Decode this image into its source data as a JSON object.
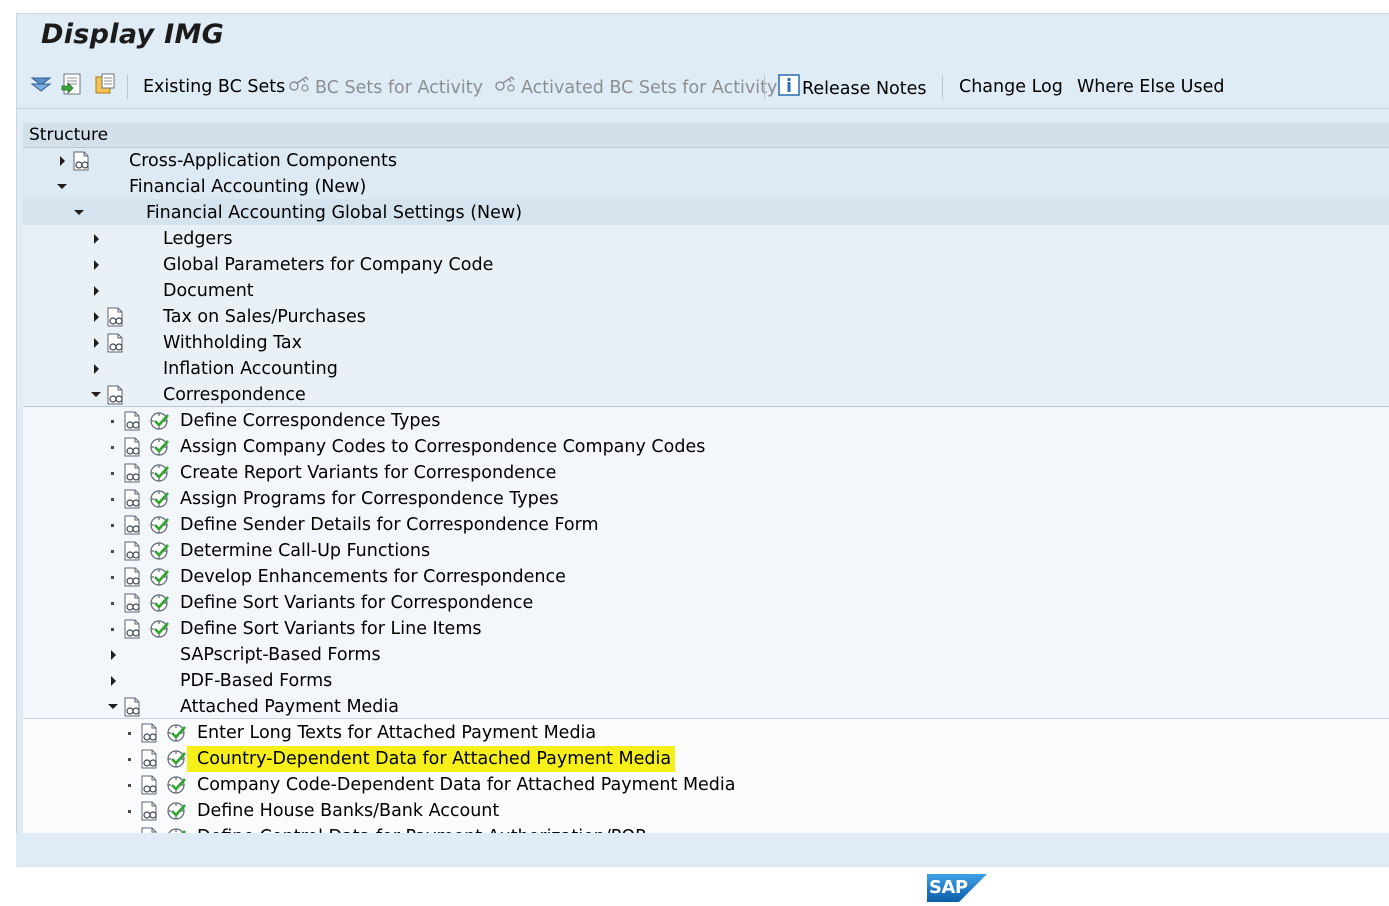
{
  "window": {
    "title": "Display IMG"
  },
  "toolbar": {
    "existing_bc_sets": "Existing BC Sets",
    "bc_sets_for_activity": "BC Sets for Activity",
    "activated_bc_sets_for_activity": "Activated BC Sets for Activity",
    "release_notes": "Release Notes",
    "change_log": "Change Log",
    "where_else_used": "Where Else Used"
  },
  "structure": {
    "header": "Structure",
    "rows": [
      {
        "text": "Cross-Application Components",
        "level": 0,
        "expander": "collapsed",
        "doc_icon": true,
        "exec_icon": false
      },
      {
        "text": "Financial Accounting (New)",
        "level": 0,
        "expander": "expanded",
        "doc_icon": false,
        "exec_icon": false
      },
      {
        "text": "Financial Accounting Global Settings (New)",
        "level": 1,
        "expander": "expanded",
        "doc_icon": false,
        "exec_icon": false
      },
      {
        "text": "Ledgers",
        "level": 2,
        "expander": "collapsed",
        "doc_icon": false,
        "exec_icon": false
      },
      {
        "text": "Global Parameters for Company Code",
        "level": 2,
        "expander": "collapsed",
        "doc_icon": false,
        "exec_icon": false
      },
      {
        "text": "Document",
        "level": 2,
        "expander": "collapsed",
        "doc_icon": false,
        "exec_icon": false
      },
      {
        "text": "Tax on Sales/Purchases",
        "level": 2,
        "expander": "collapsed",
        "doc_icon": true,
        "exec_icon": false
      },
      {
        "text": "Withholding Tax",
        "level": 2,
        "expander": "collapsed",
        "doc_icon": true,
        "exec_icon": false
      },
      {
        "text": "Inflation Accounting",
        "level": 2,
        "expander": "collapsed",
        "doc_icon": false,
        "exec_icon": false
      },
      {
        "text": "Correspondence",
        "level": 2,
        "expander": "expanded",
        "doc_icon": true,
        "exec_icon": false
      },
      {
        "text": "Define Correspondence Types",
        "level": 3,
        "expander": "leaf",
        "doc_icon": true,
        "exec_icon": true
      },
      {
        "text": "Assign Company Codes to Correspondence Company Codes",
        "level": 3,
        "expander": "leaf",
        "doc_icon": true,
        "exec_icon": true
      },
      {
        "text": "Create Report Variants for Correspondence",
        "level": 3,
        "expander": "leaf",
        "doc_icon": true,
        "exec_icon": true
      },
      {
        "text": "Assign Programs for Correspondence Types",
        "level": 3,
        "expander": "leaf",
        "doc_icon": true,
        "exec_icon": true
      },
      {
        "text": "Define Sender Details for Correspondence Form",
        "level": 3,
        "expander": "leaf",
        "doc_icon": true,
        "exec_icon": true
      },
      {
        "text": "Determine Call-Up Functions",
        "level": 3,
        "expander": "leaf",
        "doc_icon": true,
        "exec_icon": true
      },
      {
        "text": "Develop Enhancements for Correspondence",
        "level": 3,
        "expander": "leaf",
        "doc_icon": true,
        "exec_icon": true
      },
      {
        "text": "Define Sort Variants for Correspondence",
        "level": 3,
        "expander": "leaf",
        "doc_icon": true,
        "exec_icon": true
      },
      {
        "text": "Define Sort Variants for Line Items",
        "level": 3,
        "expander": "leaf",
        "doc_icon": true,
        "exec_icon": true
      },
      {
        "text": "SAPscript-Based Forms",
        "level": 3,
        "expander": "collapsed",
        "doc_icon": false,
        "exec_icon": false
      },
      {
        "text": "PDF-Based Forms",
        "level": 3,
        "expander": "collapsed",
        "doc_icon": false,
        "exec_icon": false
      },
      {
        "text": "Attached Payment Media",
        "level": 3,
        "expander": "expanded",
        "doc_icon": true,
        "exec_icon": false
      },
      {
        "text": "Enter Long Texts for Attached Payment Media",
        "level": 4,
        "expander": "leaf",
        "doc_icon": true,
        "exec_icon": true
      },
      {
        "text": "Country-Dependent Data for Attached Payment Media",
        "level": 4,
        "expander": "leaf",
        "doc_icon": true,
        "exec_icon": true,
        "highlighted": true
      },
      {
        "text": "Company Code-Dependent Data for Attached Payment Media",
        "level": 4,
        "expander": "leaf",
        "doc_icon": true,
        "exec_icon": true
      },
      {
        "text": "Define House Banks/Bank Account",
        "level": 4,
        "expander": "leaf",
        "doc_icon": true,
        "exec_icon": true
      },
      {
        "text": "Define Control Data for Payment Authorization/POR",
        "level": 4,
        "expander": "leaf",
        "doc_icon": true,
        "exec_icon": true
      }
    ]
  },
  "branding": {
    "logo_text": "SAP"
  },
  "colors": {
    "highlight": "#f7ef1a",
    "window_bg": "#dfebf5",
    "sap_blue": "#1a73c6"
  }
}
